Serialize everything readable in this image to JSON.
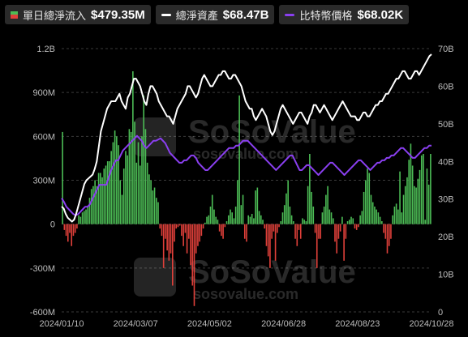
{
  "legend": {
    "inflow": {
      "label": "單日總淨流入",
      "value": "$479.35M",
      "color_pos": "#4cbc55",
      "color_neg": "#e0403a"
    },
    "assets": {
      "label": "總淨資產",
      "value": "$68.47B",
      "color": "#ffffff"
    },
    "price": {
      "label": "比特幣價格",
      "value": "$68.02K",
      "color": "#8a3ff0"
    }
  },
  "watermark": {
    "brand": "SoSoValue",
    "site": "sosovalue.com"
  },
  "chart_data": {
    "type": "bar+line",
    "x_labels": [
      "2024/01/10",
      "2024/03/07",
      "2024/05/02",
      "2024/06/28",
      "2024/08/23",
      "2024/10/28"
    ],
    "left_axis": {
      "ticks": [
        "1.2B",
        "900M",
        "600M",
        "300M",
        "0",
        "-300M",
        "-600M"
      ],
      "min": -600,
      "max": 1200,
      "unit": "M USD"
    },
    "right_axis": {
      "ticks": [
        "70B",
        "60B",
        "50B",
        "40B",
        "30B",
        "20B",
        "10B",
        "0"
      ],
      "min": 0,
      "max": 70,
      "unit": "B USD"
    },
    "daily_net_inflow_M": [
      630,
      -40,
      -80,
      -120,
      -60,
      -150,
      -80,
      -60,
      -30,
      60,
      50,
      80,
      90,
      100,
      120,
      180,
      240,
      260,
      300,
      260,
      350,
      350,
      320,
      380,
      400,
      430,
      430,
      500,
      560,
      640,
      600,
      540,
      300,
      200,
      380,
      500,
      470,
      650,
      630,
      1045,
      700,
      420,
      560,
      400,
      600,
      880,
      650,
      420,
      340,
      300,
      230,
      250,
      180,
      150,
      -30,
      -80,
      -300,
      -100,
      -180,
      -250,
      -200,
      -420,
      -120,
      -30,
      -20,
      -10,
      -80,
      -150,
      -60,
      -200,
      -100,
      -280,
      -420,
      -560,
      -200,
      -150,
      -120,
      -80,
      -30,
      10,
      50,
      60,
      120,
      200,
      100,
      50,
      30,
      -50,
      -80,
      -100,
      -20,
      20,
      60,
      100,
      80,
      40,
      120,
      300,
      880,
      130,
      200,
      -100,
      -120,
      60,
      50,
      70,
      40,
      230,
      250,
      90,
      60,
      30,
      -30,
      -150,
      -220,
      -300,
      -100,
      -50,
      -250,
      -60,
      -20,
      20,
      80,
      130,
      210,
      300,
      120,
      60,
      20,
      -100,
      -150,
      -40,
      -100,
      40,
      30,
      20,
      260,
      480,
      220,
      120,
      -60,
      -300,
      -100,
      -100,
      80,
      120,
      200,
      260,
      100,
      80,
      40,
      -120,
      -200,
      -100,
      -50,
      50,
      -250,
      -100,
      20,
      30,
      50,
      40,
      -30,
      -40,
      -20,
      60,
      90,
      220,
      300,
      380,
      350,
      200,
      150,
      120,
      100,
      80,
      50,
      20,
      -60,
      -100,
      -200,
      -150,
      -100,
      60,
      120,
      140,
      100,
      360,
      80,
      200,
      260,
      320,
      440,
      550,
      400,
      260,
      250,
      310,
      370,
      470,
      480,
      30,
      380,
      270,
      480
    ],
    "total_net_assets_B": [
      28,
      27.5,
      26,
      25,
      24.5,
      24,
      24.5,
      26,
      28,
      30,
      32,
      34,
      35,
      35.5,
      36,
      36.5,
      38,
      40,
      44,
      48,
      50,
      52,
      54,
      55,
      56,
      56,
      56,
      57,
      58,
      56,
      55,
      54,
      57,
      58,
      60,
      62,
      62,
      61,
      60,
      58,
      56,
      55,
      58,
      60,
      60,
      59,
      58,
      56,
      55,
      54,
      53,
      52,
      52,
      51,
      50,
      52,
      54,
      55,
      56,
      57,
      58,
      60,
      60,
      59,
      58,
      57,
      58,
      60,
      62,
      63,
      62,
      61,
      60,
      60,
      61,
      62,
      63,
      63,
      64,
      64,
      63,
      62,
      62,
      63,
      63,
      62,
      61,
      60,
      58,
      56,
      55,
      54,
      54,
      52,
      51,
      52,
      53,
      54,
      53,
      52,
      50,
      48,
      47,
      48,
      50,
      52,
      54,
      55,
      54,
      53,
      52,
      51,
      50,
      51,
      52,
      53,
      53,
      52,
      51,
      50,
      52,
      53,
      55,
      55,
      54,
      53,
      54,
      55,
      54,
      53,
      52,
      51,
      52,
      53,
      54,
      55,
      56,
      55,
      54,
      53,
      52,
      52,
      52,
      51,
      51,
      52,
      53,
      53,
      52,
      52,
      53,
      54,
      55,
      55,
      56,
      56,
      57,
      58,
      58,
      59,
      60,
      61,
      62,
      62,
      63,
      64,
      64,
      63,
      62,
      62,
      63,
      64,
      64,
      63,
      64,
      65,
      66,
      67,
      68,
      68.5
    ],
    "btc_price_K": [
      46.5,
      45,
      43,
      42,
      41,
      40,
      39.5,
      40,
      41,
      42,
      43,
      43,
      44,
      46,
      48,
      50,
      52,
      52,
      52,
      52,
      55,
      58,
      60,
      62,
      62,
      64,
      66,
      67,
      68,
      69,
      70,
      71,
      72,
      71,
      70,
      68,
      67,
      68,
      69,
      70,
      70,
      70.5,
      71,
      70,
      69,
      67,
      65,
      64,
      63,
      62,
      61,
      61,
      62,
      62,
      63,
      64,
      64,
      63,
      61,
      60,
      59,
      58,
      58,
      59,
      60,
      61,
      62,
      63,
      64,
      65,
      66,
      67,
      67,
      67,
      68,
      68,
      69,
      70,
      70,
      70,
      69,
      68,
      67,
      66,
      65,
      64,
      63,
      62,
      61,
      60,
      59,
      58,
      59,
      60,
      61,
      62,
      63,
      64,
      64,
      62,
      60,
      58,
      58,
      59,
      60,
      60,
      59,
      58,
      57,
      56,
      57,
      58,
      59,
      60,
      61,
      61,
      60,
      59,
      58,
      57,
      56,
      57,
      58,
      59,
      60,
      61,
      62,
      62,
      61,
      60,
      59,
      58,
      59,
      60,
      61,
      61,
      62,
      62,
      63,
      63,
      64,
      64,
      65,
      66,
      67,
      67,
      66,
      65,
      64,
      63,
      63,
      64,
      65,
      66,
      67,
      67,
      68,
      68.02
    ],
    "grid": true
  }
}
